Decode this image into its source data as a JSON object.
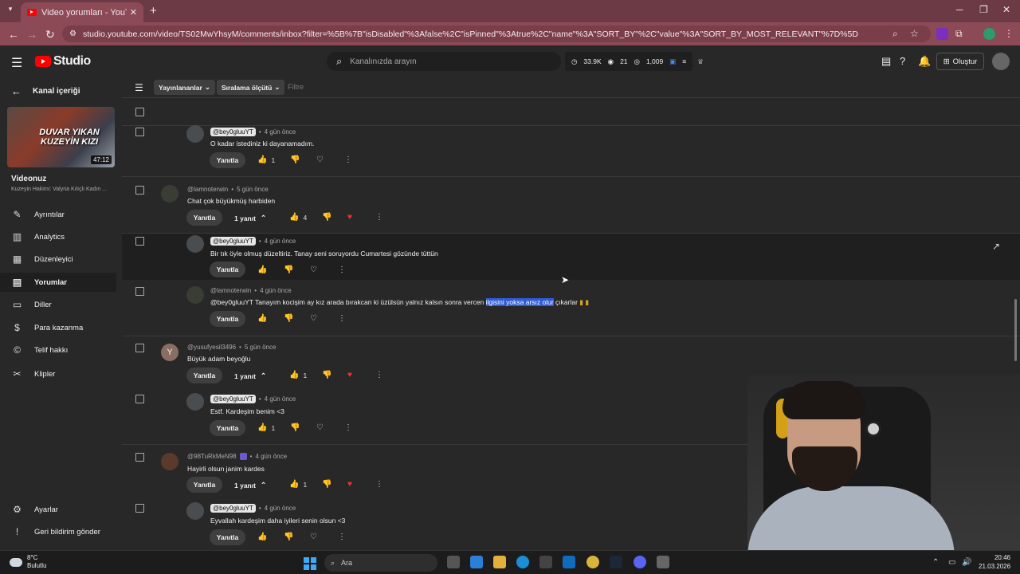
{
  "browser": {
    "tab_title": "Video yorumları - YouTube Studio",
    "url": "studio.youtube.com/video/TS02MwYhsyM/comments/inbox?filter=%5B%7B\"isDisabled\"%3Afalse%2C\"isPinned\"%3Atrue%2C\"name\"%3A\"SORT_BY\"%2C\"value\"%3A\"SORT_BY_MOST_RELEVANT\"%7D%5D"
  },
  "header": {
    "logo_text": "Studio",
    "search_placeholder": "Kanalınızda arayın",
    "stats": {
      "views": "33.9K",
      "watching": "21",
      "subs": "1,009"
    },
    "create_label": "Oluştur"
  },
  "sidebar": {
    "back_label": "Kanal içeriği",
    "thumbnail_text": "DUVAR YIKAN KUZEYİN KIZI",
    "thumbnail_duration": "47:12",
    "video_label": "Videonuz",
    "video_title": "Kuzeyin Hakimi: Valyria Kılıçlı Kadın ...",
    "items": [
      {
        "label": "Ayrıntılar",
        "icon": "pencil-icon"
      },
      {
        "label": "Analytics",
        "icon": "analytics-icon"
      },
      {
        "label": "Düzenleyici",
        "icon": "editor-icon"
      },
      {
        "label": "Yorumlar",
        "icon": "comments-icon"
      },
      {
        "label": "Diller",
        "icon": "subtitles-icon"
      },
      {
        "label": "Para kazanma",
        "icon": "dollar-icon"
      },
      {
        "label": "Telif hakkı",
        "icon": "copyright-icon"
      },
      {
        "label": "Klipler",
        "icon": "scissors-icon"
      }
    ],
    "settings_label": "Ayarlar",
    "feedback_label": "Geri bildirim gönder"
  },
  "filters": {
    "published_label": "Yayınlananlar",
    "sort_label": "Sıralama ölçütü",
    "filter_placeholder": "Filtre"
  },
  "comments": [
    {
      "author": "@bey0gluuYT",
      "owner": true,
      "time": "4 gün önce",
      "text": "O kadar istediniz ki dayanamadım.",
      "likes": "1",
      "reply": "Yanıtla"
    },
    {
      "author": "@lamnoterwin",
      "owner": false,
      "time": "5 gün önce",
      "text": "Chat çok büyükmüş harbiden",
      "likes": "4",
      "replies": "1 yanıt",
      "reply": "Yanıtla"
    },
    {
      "author": "@bey0gluuYT",
      "owner": true,
      "time": "4 gün önce",
      "text": "Bir tık öyle olmuş düzeltiriz. Tanay seni soruyordu Cumartesi gözünde tüttün",
      "likes": "",
      "reply": "Yanıtla"
    },
    {
      "author": "@lamnoterwin",
      "owner": false,
      "time": "4 gün önce",
      "text_before": "@bey0gluuYT Tanayım kocişim ay kız arada bırakcan ki üzülsün yalnız kalsın sonra vercen ",
      "text_highlight": "ilgisini yoksa arsız olur",
      "text_after": " çıkarlar",
      "likes": "",
      "reply": "Yanıtla"
    },
    {
      "author": "@yusufyesil3496",
      "owner": false,
      "time": "5 gün önce",
      "text": "Büyük adam beyoğlu",
      "likes": "1",
      "replies": "1 yanıt",
      "reply": "Yanıtla",
      "avatar_letter": "Y"
    },
    {
      "author": "@bey0gluuYT",
      "owner": true,
      "time": "4 gün önce",
      "text": "Estf. Kardeşim benim <3",
      "likes": "1",
      "reply": "Yanıtla"
    },
    {
      "author": "@98TuRkMeN98",
      "owner": false,
      "time": "4 gün önce",
      "text": "Hayirli olsun janim kardes",
      "likes": "1",
      "replies": "1 yanıt",
      "reply": "Yanıtla"
    },
    {
      "author": "@bey0gluuYT",
      "owner": true,
      "time": "4 gün önce",
      "text": "Eyvallah kardeşim daha iyileri senin olsun <3",
      "likes": "",
      "reply": "Yanıtla"
    }
  ],
  "taskbar": {
    "temp": "8°C",
    "weather": "Bulutlu",
    "search_label": "Ara",
    "time": "20:46",
    "date": "21.03.2026"
  }
}
